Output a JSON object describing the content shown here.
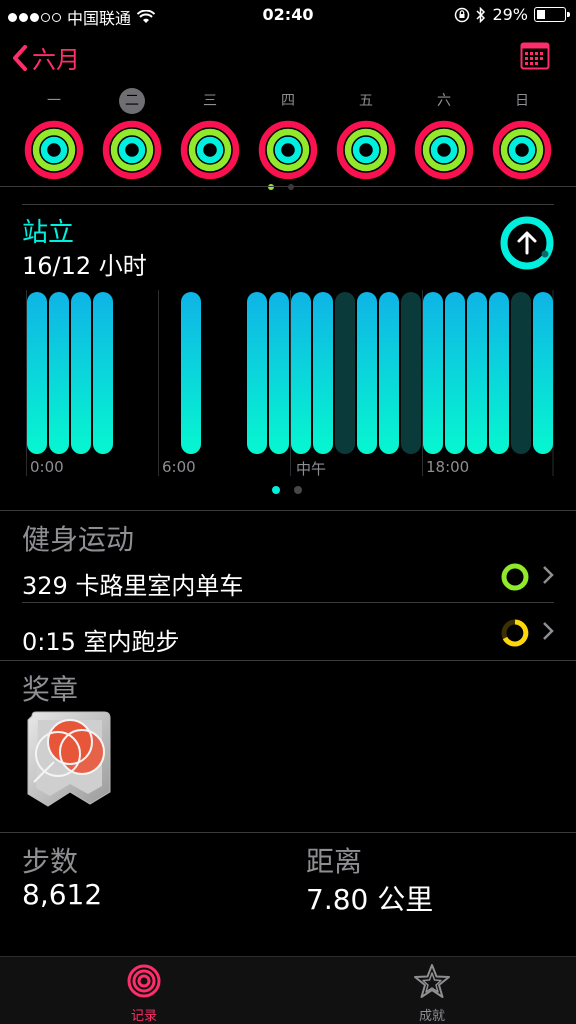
{
  "status_bar": {
    "carrier": "中国联通",
    "time": "02:40",
    "battery": "29%"
  },
  "nav": {
    "back_label": "六月"
  },
  "week": {
    "days": [
      "一",
      "二",
      "三",
      "四",
      "五",
      "六",
      "日"
    ],
    "selected_index": 1
  },
  "stand": {
    "title": "站立",
    "summary": "16/12 小时",
    "chart_data": {
      "type": "bar",
      "x_ticks": [
        "0:00",
        "6:00",
        "中午",
        "18:00"
      ],
      "hours_stood": [
        1,
        1,
        1,
        1,
        0,
        0,
        0,
        1,
        0,
        0,
        1,
        1,
        1,
        1,
        0,
        1,
        1,
        0,
        1,
        1,
        1,
        1,
        0,
        1
      ],
      "hours_active": [
        1,
        1,
        1,
        1,
        0,
        0,
        0,
        1,
        0,
        0,
        1,
        1,
        1,
        1,
        1,
        1,
        1,
        1,
        1,
        1,
        1,
        1,
        1,
        1
      ]
    }
  },
  "workouts": {
    "title": "健身运动",
    "items": [
      {
        "label": "329 卡路里室内单车"
      },
      {
        "label": "0:15 室内跑步"
      }
    ]
  },
  "awards": {
    "title": "奖章"
  },
  "stats": {
    "steps_label": "步数",
    "steps_value": "8,612",
    "distance_label": "距离",
    "distance_value": "7.80 公里"
  },
  "tabs": [
    {
      "label": "记录",
      "active": true
    },
    {
      "label": "成就",
      "active": false
    }
  ],
  "colors": {
    "accent": "#ff2d6a",
    "move": "#fa114f",
    "exercise": "#92e82a",
    "stand": "#00f0e0",
    "inactive_tab": "#8e8e93"
  }
}
